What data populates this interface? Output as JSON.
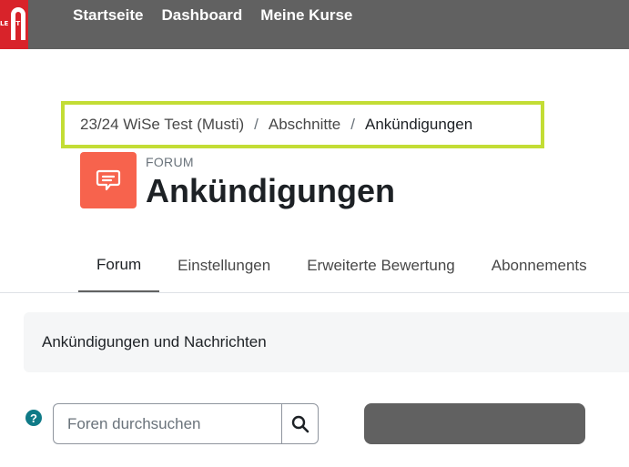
{
  "navbar": {
    "logo_text": "LE UT",
    "items": [
      {
        "label": "Startseite"
      },
      {
        "label": "Dashboard"
      },
      {
        "label": "Meine Kurse"
      }
    ]
  },
  "breadcrumb": {
    "items": [
      {
        "label": "23/24 WiSe Test (Musti)"
      },
      {
        "label": "Abschnitte"
      },
      {
        "label": "Ankündigungen"
      }
    ],
    "separator": "/"
  },
  "activity": {
    "icon": "forum-chat-icon",
    "type_label": "FORUM",
    "title": "Ankündigungen"
  },
  "tabs": [
    {
      "label": "Forum",
      "active": true
    },
    {
      "label": "Einstellungen",
      "active": false
    },
    {
      "label": "Erweiterte Bewertung",
      "active": false
    },
    {
      "label": "Abonnements",
      "active": false
    }
  ],
  "intro": {
    "text": "Ankündigungen und Nachrichten"
  },
  "search": {
    "help_icon": "?",
    "placeholder": "Foren durchsuchen",
    "value": ""
  },
  "colors": {
    "navbar": "#616161",
    "highlight": "#c3dd35",
    "forum_icon": "#f7634d",
    "help_icon": "#0f7a87"
  }
}
